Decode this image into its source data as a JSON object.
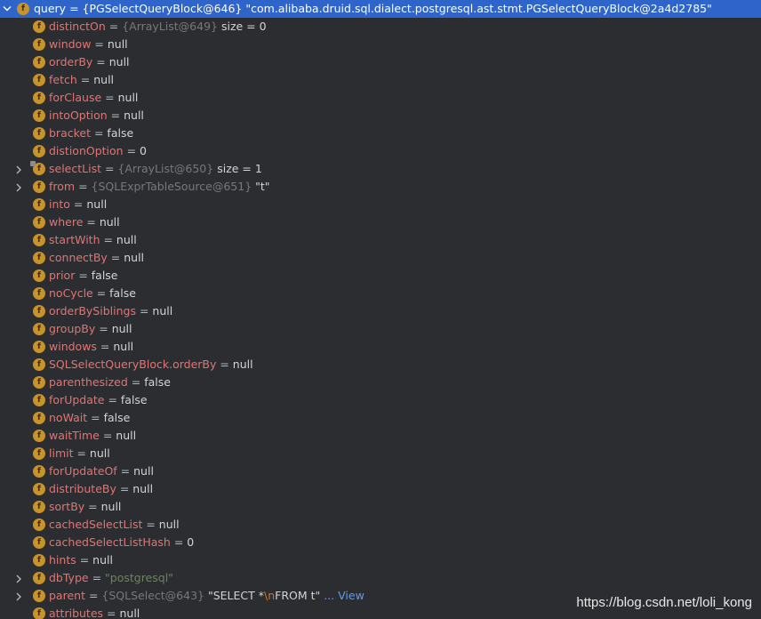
{
  "root": {
    "name": "query",
    "ref": "{PGSelectQueryBlock@646}",
    "value": "\"com.alibaba.druid.sql.dialect.postgresql.ast.stmt.PGSelectQueryBlock@2a4d2785\""
  },
  "fields": [
    {
      "name": "distinctOn",
      "ref": "{ArrayList@649}",
      "extra": "size = 0",
      "expandable": false
    },
    {
      "name": "window",
      "value": "null"
    },
    {
      "name": "orderBy",
      "value": "null"
    },
    {
      "name": "fetch",
      "value": "null"
    },
    {
      "name": "forClause",
      "value": "null"
    },
    {
      "name": "intoOption",
      "value": "null"
    },
    {
      "name": "bracket",
      "value": "false"
    },
    {
      "name": "distionOption",
      "value": "0"
    },
    {
      "name": "selectList",
      "ref": "{ArrayList@650}",
      "extra": "size = 1",
      "expandable": true,
      "locked": true
    },
    {
      "name": "from",
      "ref": "{SQLExprTableSource@651}",
      "extra": "\"t\"",
      "expandable": true
    },
    {
      "name": "into",
      "value": "null"
    },
    {
      "name": "where",
      "value": "null"
    },
    {
      "name": "startWith",
      "value": "null"
    },
    {
      "name": "connectBy",
      "value": "null"
    },
    {
      "name": "prior",
      "value": "false"
    },
    {
      "name": "noCycle",
      "value": "false"
    },
    {
      "name": "orderBySiblings",
      "value": "null"
    },
    {
      "name": "groupBy",
      "value": "null"
    },
    {
      "name": "windows",
      "value": "null"
    },
    {
      "name": "SQLSelectQueryBlock.orderBy",
      "value": "null"
    },
    {
      "name": "parenthesized",
      "value": "false"
    },
    {
      "name": "forUpdate",
      "value": "false"
    },
    {
      "name": "noWait",
      "value": "false"
    },
    {
      "name": "waitTime",
      "value": "null"
    },
    {
      "name": "limit",
      "value": "null"
    },
    {
      "name": "forUpdateOf",
      "value": "null"
    },
    {
      "name": "distributeBy",
      "value": "null"
    },
    {
      "name": "sortBy",
      "value": "null"
    },
    {
      "name": "cachedSelectList",
      "value": "null"
    },
    {
      "name": "cachedSelectListHash",
      "value": "0"
    },
    {
      "name": "hints",
      "value": "null"
    },
    {
      "name": "dbType",
      "str": "\"postgresql\"",
      "expandable": true
    },
    {
      "name": "parent",
      "ref": "{SQLSelect@643}",
      "parentValue": {
        "pre": "\"SELECT *",
        "esc": "\\n",
        "post": "FROM t\"",
        "ellipsis": " ...",
        "link": "View"
      },
      "expandable": true
    },
    {
      "name": "attributes",
      "value": "null"
    }
  ],
  "field_icon_letter": "f",
  "watermark": "https://blog.csdn.net/loli_kong",
  "colors": {
    "background": "#2b2d30",
    "selected_row": "#2f65ca",
    "field_name": "#e57373",
    "field_icon": "#c7932b",
    "string_value": "#6a8759",
    "ref_value": "#787878",
    "link": "#589df6"
  }
}
